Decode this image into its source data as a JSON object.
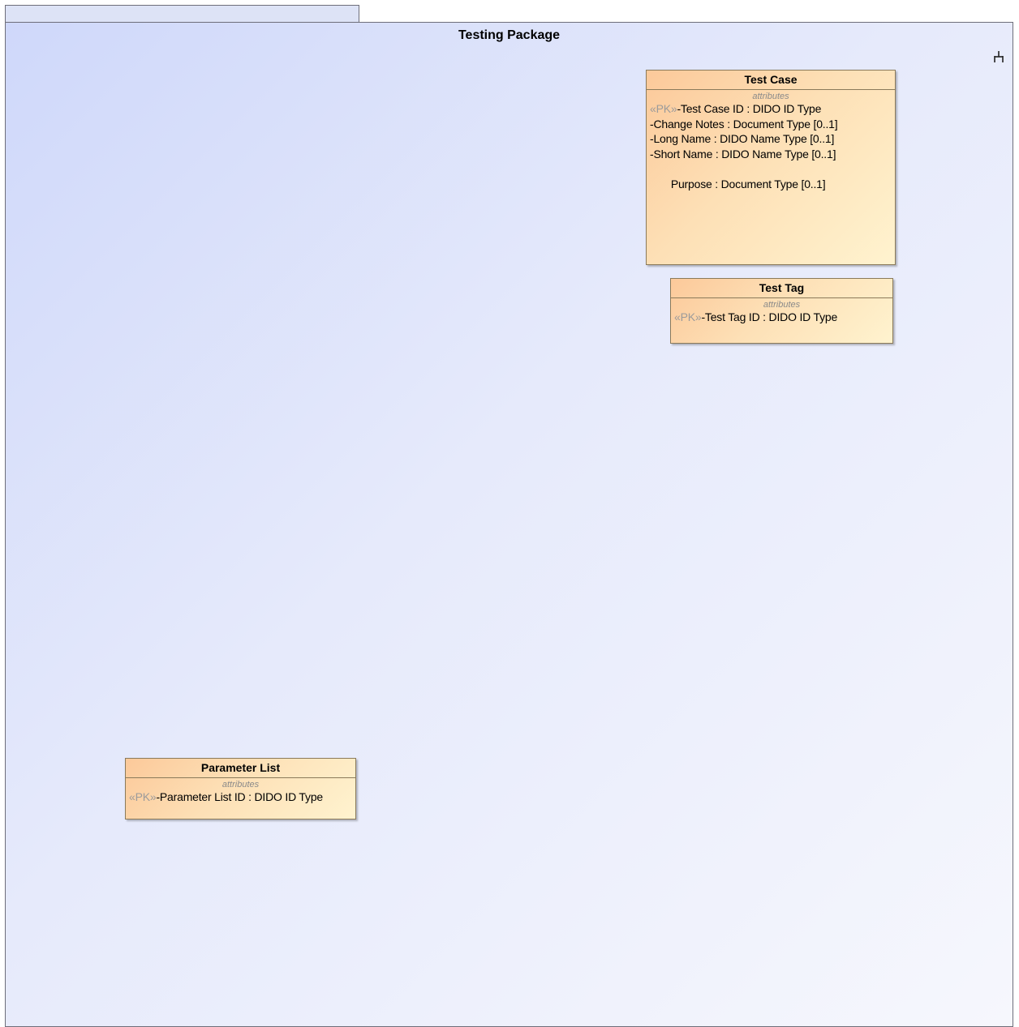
{
  "package": {
    "title": "Testing Package"
  },
  "classes": {
    "test_case": {
      "name": "Test Case",
      "compartment_label": "attributes",
      "attributes": [
        {
          "stereotype": "«PK»",
          "text": "-Test Case ID : DIDO ID Type"
        },
        {
          "stereotype": "",
          "text": "-Change Notes : Document Type [0..1]"
        },
        {
          "stereotype": "",
          "text": "-Long Name : DIDO Name Type [0..1]"
        },
        {
          "stereotype": "",
          "text": "-Short Name : DIDO Name Type [0..1]"
        },
        {
          "stereotype": "",
          "text": " Purpose : Document Type [0..1]"
        }
      ]
    },
    "test_tag": {
      "name": "Test Tag",
      "compartment_label": "attributes",
      "attributes": [
        {
          "stereotype": "«PK»",
          "text": "-Test Tag ID : DIDO ID Type"
        }
      ]
    },
    "parameter_list": {
      "name": "Parameter List",
      "compartment_label": "attributes",
      "attributes": [
        {
          "stereotype": "«PK»",
          "text": "-Parameter List ID : DIDO ID Type"
        }
      ]
    }
  },
  "icons": {
    "hierarchy": "hierarchy-icon"
  },
  "colors": {
    "class_fill_start": "#fcc99a",
    "class_fill_end": "#fff3cf",
    "package_fill_start": "#cfd8fa",
    "package_fill_end": "#f6f7fd",
    "stereotype_text": "#9b9b9b"
  }
}
